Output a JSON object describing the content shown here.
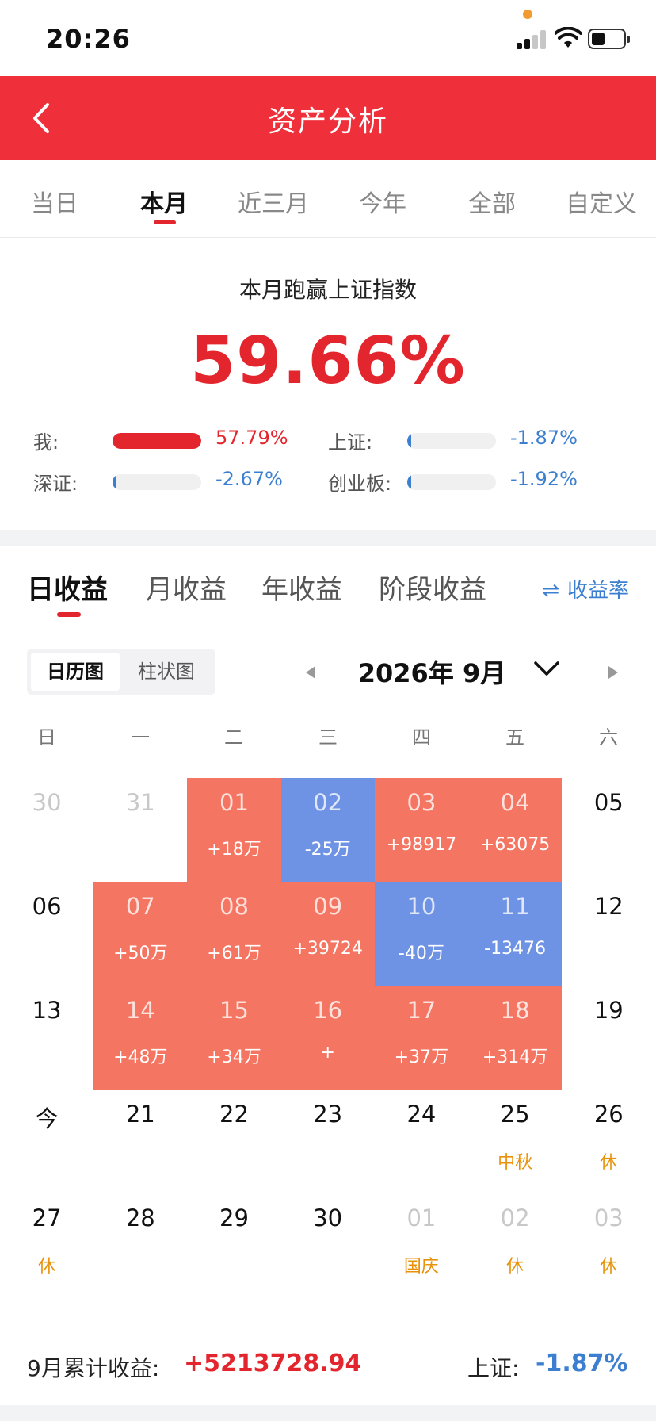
{
  "status_bar": {
    "time": "20:26"
  },
  "header": {
    "title": "资产分析"
  },
  "period_tabs": [
    "当日",
    "本月",
    "近三月",
    "今年",
    "全部",
    "自定义"
  ],
  "period_active": "本月",
  "summary": {
    "label": "本月跑赢上证指数",
    "value": "59.66%",
    "comparisons": [
      {
        "label": "我:",
        "value": "57.79%",
        "color": "#e3262e",
        "fill_fraction": 1.0
      },
      {
        "label": "上证:",
        "value": "-1.87%",
        "color": "#3c7fd0",
        "fill_fraction": 0.03
      },
      {
        "label": "深证:",
        "value": "-2.67%",
        "color": "#3c7fd0",
        "fill_fraction": 0.04
      },
      {
        "label": "创业板:",
        "value": "-1.92%",
        "color": "#3c7fd0",
        "fill_fraction": 0.03
      }
    ]
  },
  "earnings_tabs": [
    "日收益",
    "月收益",
    "年收益",
    "阶段收益"
  ],
  "earnings_active": "日收益",
  "rate_toggle": {
    "label": "收益率"
  },
  "view_toggle": [
    "日历图",
    "柱状图"
  ],
  "view_active": "日历图",
  "month": {
    "label": "2026年 9月"
  },
  "weekdays": [
    "日",
    "一",
    "二",
    "三",
    "四",
    "五",
    "六"
  ],
  "calendar": [
    [
      {
        "day": "30",
        "type": "other"
      },
      {
        "day": "31",
        "type": "other"
      },
      {
        "day": "01",
        "type": "pos",
        "value": "+18万"
      },
      {
        "day": "02",
        "type": "neg",
        "value": "-25万"
      },
      {
        "day": "03",
        "type": "pos",
        "value": "+98917"
      },
      {
        "day": "04",
        "type": "pos",
        "value": "+63075"
      },
      {
        "day": "05",
        "type": "normal"
      }
    ],
    [
      {
        "day": "06",
        "type": "normal"
      },
      {
        "day": "07",
        "type": "pos",
        "value": "+50万"
      },
      {
        "day": "08",
        "type": "pos",
        "value": "+61万"
      },
      {
        "day": "09",
        "type": "pos",
        "value": "+39724"
      },
      {
        "day": "10",
        "type": "neg",
        "value": "-40万"
      },
      {
        "day": "11",
        "type": "neg",
        "value": "-13476"
      },
      {
        "day": "12",
        "type": "normal"
      }
    ],
    [
      {
        "day": "13",
        "type": "normal"
      },
      {
        "day": "14",
        "type": "pos",
        "value": "+48万"
      },
      {
        "day": "15",
        "type": "pos",
        "value": "+34万"
      },
      {
        "day": "16",
        "type": "pos",
        "value": "+"
      },
      {
        "day": "17",
        "type": "pos",
        "value": "+37万"
      },
      {
        "day": "18",
        "type": "pos",
        "value": "+314万"
      },
      {
        "day": "19",
        "type": "normal"
      }
    ],
    [
      {
        "day": "今",
        "type": "normal"
      },
      {
        "day": "21",
        "type": "normal"
      },
      {
        "day": "22",
        "type": "normal"
      },
      {
        "day": "23",
        "type": "normal"
      },
      {
        "day": "24",
        "type": "normal"
      },
      {
        "day": "25",
        "type": "normal",
        "note": "中秋"
      },
      {
        "day": "26",
        "type": "normal",
        "note": "休"
      }
    ],
    [
      {
        "day": "27",
        "type": "normal",
        "note": "休"
      },
      {
        "day": "28",
        "type": "normal"
      },
      {
        "day": "29",
        "type": "normal"
      },
      {
        "day": "30",
        "type": "normal"
      },
      {
        "day": "01",
        "type": "other",
        "note": "国庆"
      },
      {
        "day": "02",
        "type": "other",
        "note": "休"
      },
      {
        "day": "03",
        "type": "other",
        "note": "休"
      }
    ]
  ],
  "totals": {
    "label": "9月累计收益:",
    "value": "+5213728.94",
    "index_label": "上证:",
    "index_value": "-1.87%"
  },
  "colors": {
    "brand_red": "#ef2f3a",
    "gain": "#f47561",
    "loss": "#6f93e4",
    "holiday": "#e8920b",
    "blue_text": "#3c7fd0"
  }
}
